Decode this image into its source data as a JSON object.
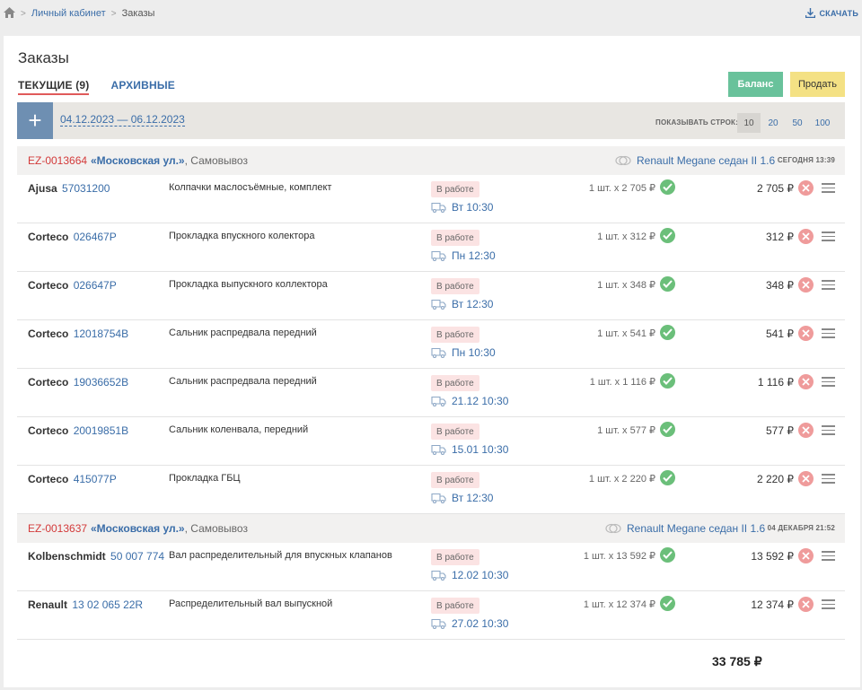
{
  "breadcrumb": {
    "home_icon": "home-icon",
    "items": [
      "Личный кабинет",
      "Заказы"
    ]
  },
  "download": {
    "label": "СКАЧАТЬ",
    "icon": "download-icon"
  },
  "page": {
    "title": "Заказы"
  },
  "tabs": [
    {
      "label": "ТЕКУЩИЕ (9)",
      "active": true
    },
    {
      "label": "АРХИВНЫЕ",
      "active": false
    }
  ],
  "actions": {
    "balance": "Баланс",
    "sell": "Продать"
  },
  "filter": {
    "add_label": "+",
    "date_range": "04.12.2023 — 06.12.2023",
    "rows_label": "ПОКАЗЫВАТЬ СТРОК:",
    "rows_options": [
      "10",
      "20",
      "50",
      "100"
    ],
    "rows_selected": "10"
  },
  "orders": [
    {
      "id": "EZ-0013664",
      "address": "«Московская ул.»",
      "delivery_type": ", Самовывоз",
      "car": "Renault Megane седан II 1.6",
      "date": "СЕГОДНЯ 13:39",
      "items": [
        {
          "brand": "Ajusa",
          "code": "57031200",
          "description": "Колпачки маслосъёмные, комплект",
          "status": "В работе",
          "delivery": "Вт 10:30",
          "qty": "1 шт. x 2 705 ₽",
          "price": "2 705 ₽"
        },
        {
          "brand": "Corteco",
          "code": "026467P",
          "description": "Прокладка впускного колектора",
          "status": "В работе",
          "delivery": "Пн 12:30",
          "qty": "1 шт. x 312 ₽",
          "price": "312 ₽"
        },
        {
          "brand": "Corteco",
          "code": "026647P",
          "description": "Прокладка выпускного коллектора",
          "status": "В работе",
          "delivery": "Вт 12:30",
          "qty": "1 шт. x 348 ₽",
          "price": "348 ₽"
        },
        {
          "brand": "Corteco",
          "code": "12018754B",
          "description": "Сальник распредвала передний",
          "status": "В работе",
          "delivery": "Пн 10:30",
          "qty": "1 шт. x 541 ₽",
          "price": "541 ₽"
        },
        {
          "brand": "Corteco",
          "code": "19036652B",
          "description": "Сальник распредвала передний",
          "status": "В работе",
          "delivery": "21.12 10:30",
          "qty": "1 шт. x 1 116 ₽",
          "price": "1 116 ₽"
        },
        {
          "brand": "Corteco",
          "code": "20019851B",
          "description": "Сальник коленвала, передний",
          "status": "В работе",
          "delivery": "15.01 10:30",
          "qty": "1 шт. x 577 ₽",
          "price": "577 ₽"
        },
        {
          "brand": "Corteco",
          "code": "415077P",
          "description": "Прокладка ГБЦ",
          "status": "В работе",
          "delivery": "Вт 12:30",
          "qty": "1 шт. x 2 220 ₽",
          "price": "2 220 ₽"
        }
      ]
    },
    {
      "id": "EZ-0013637",
      "address": "«Московская ул.»",
      "delivery_type": ", Самовывоз",
      "car": "Renault Megane седан II 1.6",
      "date": "04 ДЕКАБРЯ 21:52",
      "items": [
        {
          "brand": "Kolbenschmidt",
          "code": "50 007 774",
          "description": "Вал распределительный для впускных клапанов",
          "status": "В работе",
          "delivery": "12.02 10:30",
          "qty": "1 шт. x 13 592 ₽",
          "price": "13 592 ₽"
        },
        {
          "brand": "Renault",
          "code": "13 02 065 22R",
          "description": "Распределительный вал выпускной",
          "status": "В работе",
          "delivery": "27.02 10:30",
          "qty": "1 шт. x 12 374 ₽",
          "price": "12 374 ₽"
        }
      ]
    }
  ],
  "total": "33 785 ₽",
  "colors": {
    "accent": "#3a6da8",
    "order_id": "#d33a3a",
    "balance_btn": "#69c29b",
    "sell_btn": "#f4e184",
    "ok": "#6bbf7a",
    "cancel": "#ef9b9b",
    "status_bg": "#fbe3e3"
  }
}
